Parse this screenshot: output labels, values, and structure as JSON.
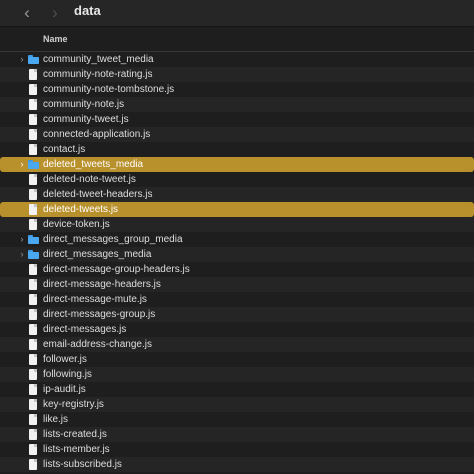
{
  "window": {
    "title": "data",
    "back_glyph": "‹",
    "forward_glyph": "›"
  },
  "columns": {
    "name": "Name"
  },
  "icons": {
    "folder": "folder-icon",
    "file": "js-file-icon",
    "disclosure": "chevron-right-icon"
  },
  "colors": {
    "selection": "#b8902c",
    "folder": "#4aa8f0",
    "background": "#1e1e1e",
    "row_alt": "#252525"
  },
  "files": [
    {
      "name": "community_tweet_media",
      "type": "folder",
      "selected": false
    },
    {
      "name": "community-note-rating.js",
      "type": "file",
      "selected": false
    },
    {
      "name": "community-note-tombstone.js",
      "type": "file",
      "selected": false
    },
    {
      "name": "community-note.js",
      "type": "file",
      "selected": false
    },
    {
      "name": "community-tweet.js",
      "type": "file",
      "selected": false
    },
    {
      "name": "connected-application.js",
      "type": "file",
      "selected": false
    },
    {
      "name": "contact.js",
      "type": "file",
      "selected": false
    },
    {
      "name": "deleted_tweets_media",
      "type": "folder",
      "selected": true
    },
    {
      "name": "deleted-note-tweet.js",
      "type": "file",
      "selected": false
    },
    {
      "name": "deleted-tweet-headers.js",
      "type": "file",
      "selected": false
    },
    {
      "name": "deleted-tweets.js",
      "type": "file",
      "selected": true
    },
    {
      "name": "device-token.js",
      "type": "file",
      "selected": false
    },
    {
      "name": "direct_messages_group_media",
      "type": "folder",
      "selected": false
    },
    {
      "name": "direct_messages_media",
      "type": "folder",
      "selected": false
    },
    {
      "name": "direct-message-group-headers.js",
      "type": "file",
      "selected": false
    },
    {
      "name": "direct-message-headers.js",
      "type": "file",
      "selected": false
    },
    {
      "name": "direct-message-mute.js",
      "type": "file",
      "selected": false
    },
    {
      "name": "direct-messages-group.js",
      "type": "file",
      "selected": false
    },
    {
      "name": "direct-messages.js",
      "type": "file",
      "selected": false
    },
    {
      "name": "email-address-change.js",
      "type": "file",
      "selected": false
    },
    {
      "name": "follower.js",
      "type": "file",
      "selected": false
    },
    {
      "name": "following.js",
      "type": "file",
      "selected": false
    },
    {
      "name": "ip-audit.js",
      "type": "file",
      "selected": false
    },
    {
      "name": "key-registry.js",
      "type": "file",
      "selected": false
    },
    {
      "name": "like.js",
      "type": "file",
      "selected": false
    },
    {
      "name": "lists-created.js",
      "type": "file",
      "selected": false
    },
    {
      "name": "lists-member.js",
      "type": "file",
      "selected": false
    },
    {
      "name": "lists-subscribed.js",
      "type": "file",
      "selected": false
    }
  ]
}
